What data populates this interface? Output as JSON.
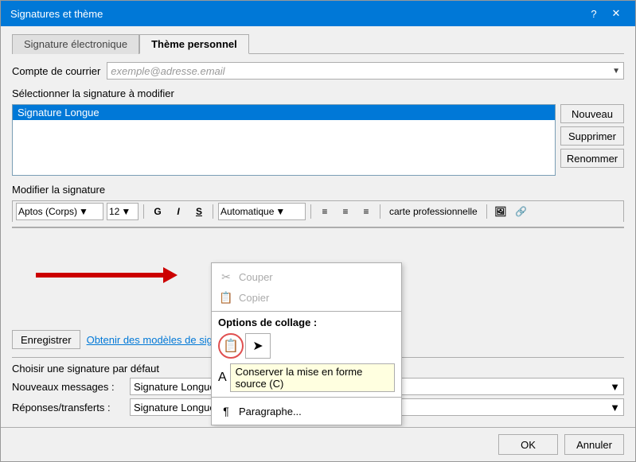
{
  "window": {
    "title": "Signatures et thème",
    "help_btn": "?",
    "close_btn": "✕"
  },
  "tabs": [
    {
      "id": "signature",
      "label": "Signature électronique",
      "active": false
    },
    {
      "id": "theme",
      "label": "Thème personnel",
      "active": true
    }
  ],
  "compte_label": "Compte de courrier",
  "compte_value": "exemple@adresse.email",
  "select_sig_label": "Sélectionner la signature à modifier",
  "signatures": [
    {
      "name": "Signature Longue",
      "selected": true
    }
  ],
  "sig_buttons": {
    "new": "Nouveau",
    "delete": "Supprimer",
    "rename": "Renommer"
  },
  "modify_label": "Modifier la signature",
  "toolbar": {
    "font": "Aptos (Corps)",
    "size": "12",
    "bold": "G",
    "italic": "I",
    "underline": "S",
    "color_label": "Automatique",
    "align_left": "≡",
    "align_center": "≡",
    "align_right": "≡",
    "card_label": "carte professionnelle"
  },
  "save_btn": "Enregistrer",
  "models_link": "Obtenir des modèles de signature",
  "default_sig": {
    "title": "Choisir une signature par défaut",
    "new_messages_label": "Nouveaux messages :",
    "new_messages_value": "Signature Longue",
    "replies_label": "Réponses/transferts :",
    "replies_value": "Signature Longue"
  },
  "context_menu": {
    "cut": "Couper",
    "copy": "Copier",
    "paste_options": "Options de collage :",
    "keep_format": "Conserver la mise en forme source (C)",
    "paragraph": "Paragraphe..."
  },
  "ok_btn": "OK",
  "cancel_btn": "Annuler"
}
